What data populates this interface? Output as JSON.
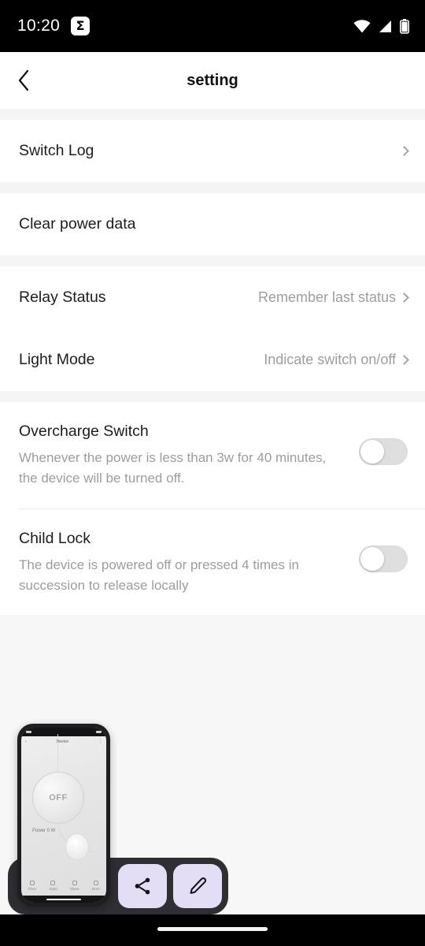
{
  "status_bar": {
    "time": "10:20",
    "notification_icon": "sigma-icon",
    "sigma_glyph": "Σ",
    "icons": [
      "wifi-icon",
      "cellular-signal-icon",
      "battery-icon"
    ]
  },
  "header": {
    "back_icon": "back-chevron-icon",
    "title": "setting"
  },
  "sections": [
    {
      "rows": [
        {
          "label": "Switch Log",
          "value": "",
          "chevron": true
        }
      ]
    },
    {
      "rows": [
        {
          "label": "Clear power data",
          "value": "",
          "chevron": false
        }
      ]
    },
    {
      "rows": [
        {
          "label": "Relay Status",
          "value": "Remember last status",
          "chevron": true
        },
        {
          "label": "Light Mode",
          "value": "Indicate switch on/off",
          "chevron": true
        }
      ]
    }
  ],
  "toggle_rows": [
    {
      "title": "Overcharge Switch",
      "desc": "Whenever the power is less than 3w for 40 minutes, the device will be turned off.",
      "state": "off"
    },
    {
      "title": "Child Lock",
      "desc": "The device is powered off or pressed 4 times in succession to release locally",
      "state": "off"
    }
  ],
  "screenshot_overlay": {
    "share_icon": "share-icon",
    "edit_icon": "pencil-edit-icon",
    "thumbnail": {
      "header_title": "Device",
      "knob_label": "OFF",
      "power_label": "Power 0 W",
      "tabs": [
        "Timer",
        "Stats",
        "Share",
        "More"
      ]
    }
  },
  "nav_bar": {
    "gesture_pill": "home-gesture-pill"
  }
}
